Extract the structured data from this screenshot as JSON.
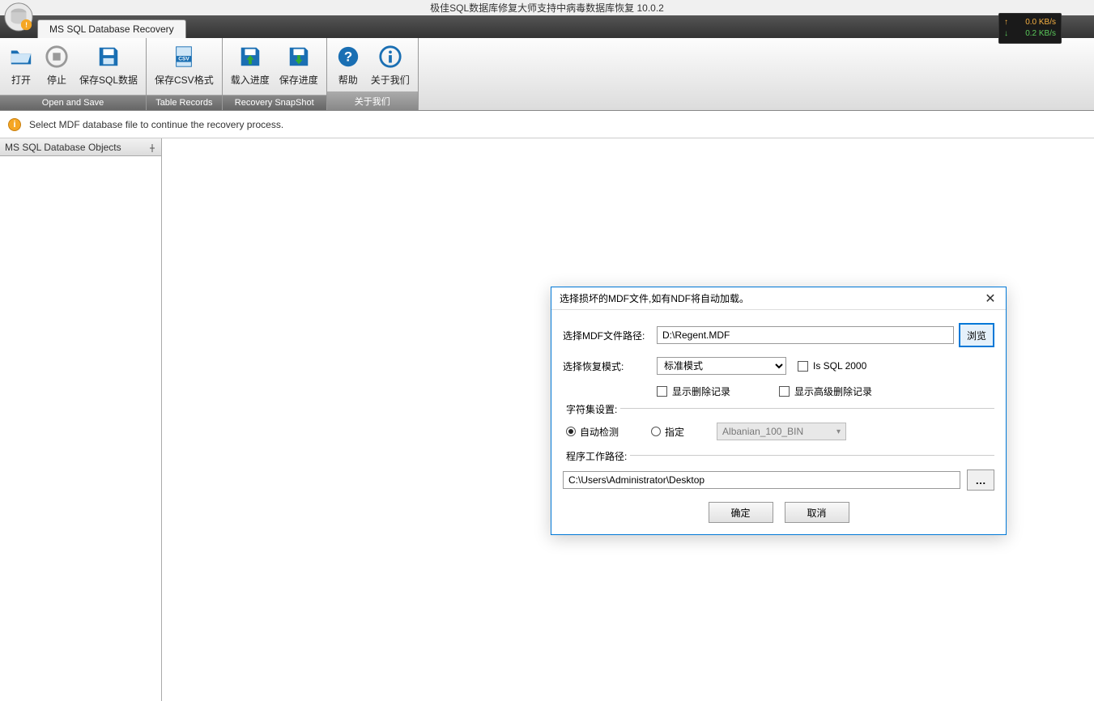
{
  "window": {
    "title": "极佳SQL数据库修复大师支持中病毒数据库恢复 10.0.2"
  },
  "network_overlay": {
    "upload": "0.0 KB/s",
    "download": "0.2 KB/s"
  },
  "tab": {
    "label": "MS SQL Database Recovery"
  },
  "ribbon": {
    "groups": {
      "open_save": {
        "caption": "Open and Save",
        "open": "打开",
        "stop": "停止",
        "save_sql": "保存SQL数据"
      },
      "table_records": {
        "caption": "Table Records",
        "save_csv": "保存CSV格式"
      },
      "recovery_snapshot": {
        "caption": "Recovery SnapShot",
        "load_progress": "载入进度",
        "save_progress": "保存进度"
      },
      "about": {
        "caption": "关于我们",
        "help": "帮助",
        "about_us": "关于我们"
      }
    }
  },
  "infobar": {
    "message": "Select MDF database file to continue the recovery process."
  },
  "sidebar": {
    "title": "MS SQL Database Objects"
  },
  "dialog": {
    "title": "选择损坏的MDF文件,如有NDF将自动加载。",
    "mdf_path_label": "选择MDF文件路径:",
    "mdf_path_value": "D:\\Regent.MDF",
    "browse_label": "浏览",
    "recovery_mode_label": "选择恢复模式:",
    "recovery_mode_value": "标准模式",
    "is_sql2000_label": "Is SQL 2000",
    "show_deleted_label": "显示删除记录",
    "show_adv_deleted_label": "显示高级删除记录",
    "charset_legend": "字符集设置:",
    "auto_detect_label": "自动检测",
    "specify_label": "指定",
    "charset_value": "Albanian_100_BIN",
    "workpath_legend": "程序工作路径:",
    "workpath_value": "C:\\Users\\Administrator\\Desktop",
    "ok_label": "确定",
    "cancel_label": "取消"
  }
}
